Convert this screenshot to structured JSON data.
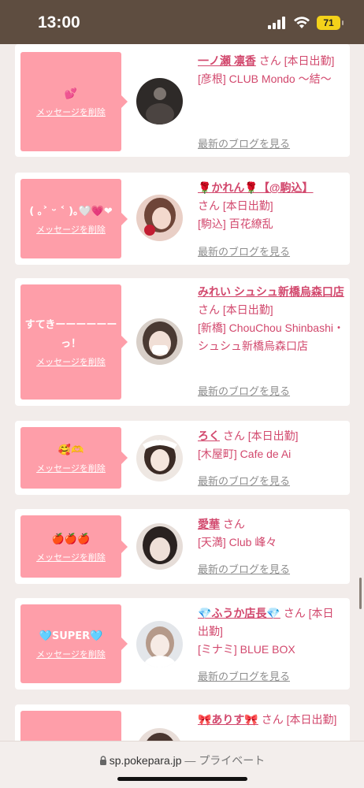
{
  "status": {
    "time": "13:00",
    "battery": "71"
  },
  "delete_label": "メッセージを削除",
  "blog_label": "最新のブログを見る",
  "cards": [
    {
      "message": "💕",
      "name": "一ノ瀬 凛香",
      "san": "さん",
      "today": "[本日出勤]",
      "shop": "[彦根] CLUB Mondo 〜結〜"
    },
    {
      "message": "( ｡˃ ᵕ ˂ )｡🤍💗❤",
      "name": "🌹かれん🌹【@駒込】",
      "san": "さん",
      "today": "[本日出勤]",
      "shop": "[駒込] 百花繚乱"
    },
    {
      "message": "すてきーーーーーーっ！",
      "name": "みれい シュシュ新橋烏森口店",
      "san": "さん",
      "today": "[本日出勤]",
      "shop": "[新橋] ChouChou Shinbashi・シュシュ新橋烏森口店"
    },
    {
      "message": "🥰🫶",
      "name": "ろく",
      "san": "さん",
      "today": "[本日出勤]",
      "shop": "[木屋町] Cafe de Ai"
    },
    {
      "message": "🍎🍎🍎",
      "name": "愛華",
      "san": "さん",
      "today": "",
      "shop": "[天満] Club 峰々"
    },
    {
      "message": "🩵SUPER🩵",
      "name": "💎ふうか店長💎",
      "san": "さん",
      "today": "[本日出勤]",
      "shop": "[ミナミ] BLUE BOX"
    },
    {
      "message": "🐰🎀",
      "name": "🎀ありす🎀",
      "san": "さん",
      "today": "[本日出勤]",
      "shop": ""
    }
  ],
  "url_bar": {
    "domain": "sp.pokepara.jp",
    "separator": " — ",
    "mode": "プライベート"
  }
}
